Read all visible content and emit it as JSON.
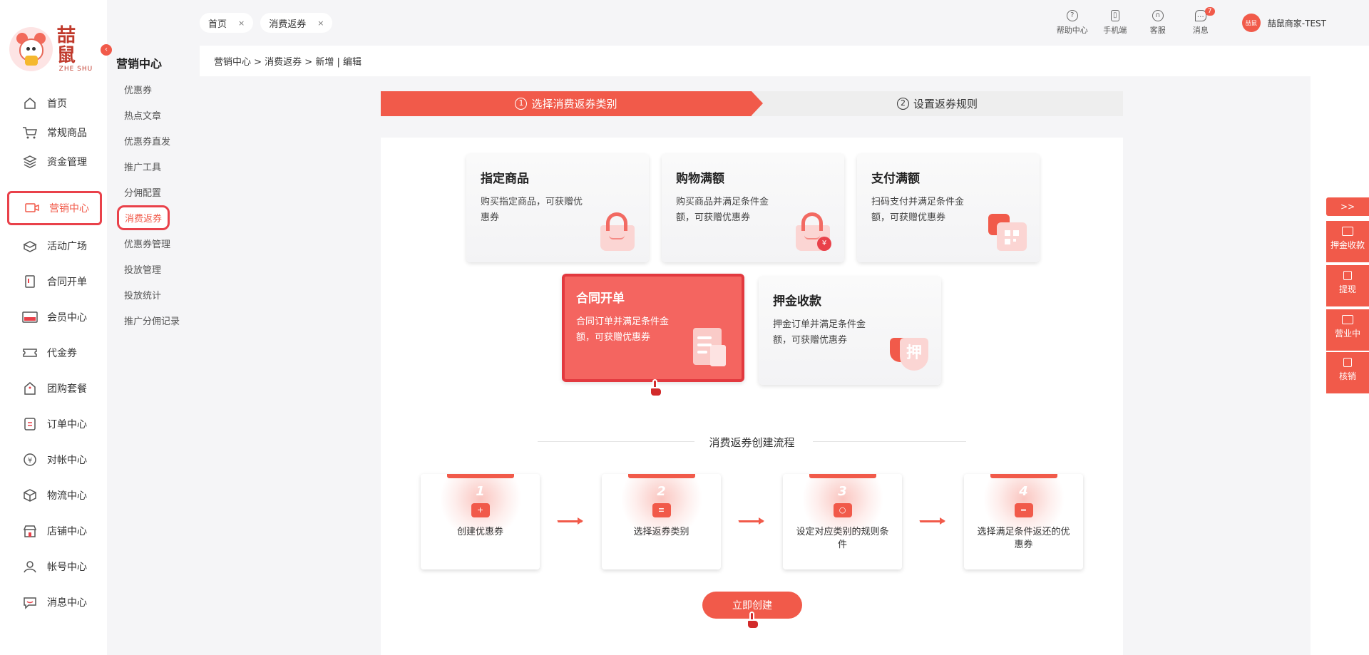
{
  "logo": {
    "cn": "喆鼠",
    "en": "ZHE SHU"
  },
  "nav": [
    {
      "label": "首页",
      "icon": "home-icon"
    },
    {
      "label": "常规商品",
      "icon": "cart-icon"
    },
    {
      "label": "资金管理",
      "icon": "layers-icon"
    },
    {
      "label": "营销中心",
      "icon": "marketing-icon",
      "active": true
    },
    {
      "label": "活动广场",
      "icon": "box-icon"
    },
    {
      "label": "合同开单",
      "icon": "contract-icon"
    },
    {
      "label": "会员中心",
      "icon": "vip-icon"
    },
    {
      "label": "代金券",
      "icon": "ticket-icon"
    },
    {
      "label": "团购套餐",
      "icon": "tag-icon"
    },
    {
      "label": "订单中心",
      "icon": "order-icon"
    },
    {
      "label": "对帐中心",
      "icon": "yen-icon"
    },
    {
      "label": "物流中心",
      "icon": "package-icon"
    },
    {
      "label": "店铺中心",
      "icon": "shop-icon"
    },
    {
      "label": "帐号中心",
      "icon": "user-icon"
    },
    {
      "label": "消息中心",
      "icon": "chat-icon"
    }
  ],
  "subnav": {
    "title": "营销中心",
    "items": [
      "优惠券",
      "热点文章",
      "优惠券直发",
      "推广工具",
      "分佣配置",
      "消费返券",
      "优惠券管理",
      "投放管理",
      "投放统计",
      "推广分佣记录"
    ],
    "active_index": 5
  },
  "tabs": [
    {
      "label": "首页"
    },
    {
      "label": "消费返券"
    }
  ],
  "tab_close": "×",
  "toolbar": [
    {
      "label": "帮助中心",
      "icon": "help-icon",
      "glyph": "?"
    },
    {
      "label": "手机端",
      "icon": "phone-icon",
      "glyph": "▯"
    },
    {
      "label": "客服",
      "icon": "headset-icon",
      "glyph": "∩"
    },
    {
      "label": "消息",
      "icon": "message-icon",
      "glyph": "…",
      "badge": "7"
    }
  ],
  "user": {
    "name": "喆鼠商家-TEST",
    "avatar": "喆鼠"
  },
  "breadcrumb": "营销中心 > 消费返券 > 新增 | 编辑",
  "steps": [
    {
      "num": "1",
      "label": "选择消费返券类别"
    },
    {
      "num": "2",
      "label": "设置返券规则"
    }
  ],
  "categories": [
    {
      "title": "指定商品",
      "desc": "购买指定商品，可获赠优惠券"
    },
    {
      "title": "购物满额",
      "desc": "购买商品并满足条件金额，可获赠优惠券",
      "coin": "¥"
    },
    {
      "title": "支付满额",
      "desc": "扫码支付并满足条件金额，可获赠优惠券"
    },
    {
      "title": "合同开单",
      "desc": "合同订单并满足条件金额，可获赠优惠券",
      "selected": true
    },
    {
      "title": "押金收款",
      "desc": "押金订单并满足条件金额，可获赠优惠券",
      "glyph": "押"
    }
  ],
  "flow": {
    "title": "消费返券创建流程",
    "steps": [
      {
        "num": "1",
        "label": "创建优惠券",
        "glyph": "+"
      },
      {
        "num": "2",
        "label": "选择返券类别",
        "glyph": "≡"
      },
      {
        "num": "3",
        "label": "设定对应类别的规则条件",
        "glyph": "○"
      },
      {
        "num": "4",
        "label": "选择满足条件返还的优惠券",
        "glyph": "="
      }
    ]
  },
  "create_button": "立即创建",
  "right_float": {
    "toggle": ">>",
    "items": [
      "押金收款",
      "提现",
      "营业中",
      "核销"
    ]
  },
  "colors": {
    "accent": "#f15a4a",
    "highlight": "#e9414a"
  }
}
